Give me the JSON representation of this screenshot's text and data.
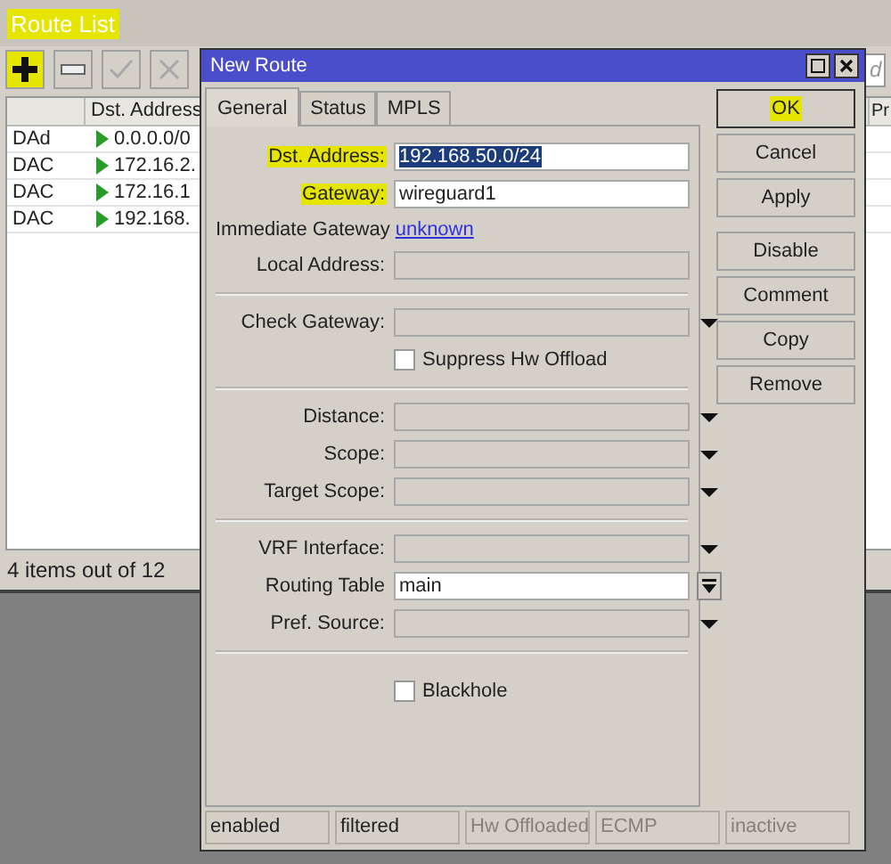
{
  "route_list": {
    "title": "Route List",
    "title_highlighted": true,
    "toolbar": [
      {
        "kind": "add",
        "highlighted": true,
        "disabled": false
      },
      {
        "kind": "remove",
        "highlighted": false,
        "disabled": false
      },
      {
        "kind": "enable",
        "highlighted": false,
        "disabled": true
      },
      {
        "kind": "disable",
        "highlighted": false,
        "disabled": true
      }
    ],
    "find_field": {
      "placeholder": "d"
    },
    "table": {
      "columns": [
        "Dst. Address",
        "Pr"
      ],
      "rows": [
        {
          "flags": "DAd",
          "dst_address": "0.0.0.0/0"
        },
        {
          "flags": "DAC",
          "dst_address": "172.16.2."
        },
        {
          "flags": "DAC",
          "dst_address": "172.16.1"
        },
        {
          "flags": "DAC",
          "dst_address": "192.168."
        }
      ]
    },
    "status": "4 items out of 12"
  },
  "dialog": {
    "title": "New Route",
    "tabs": [
      {
        "label": "General",
        "selected": true
      },
      {
        "label": "Status",
        "selected": false
      },
      {
        "label": "MPLS",
        "selected": false
      }
    ],
    "form": [
      {
        "kind": "text",
        "label": "Dst. Address:",
        "label_highlighted": true,
        "value": "192.168.50.0/24",
        "value_selected": true
      },
      {
        "kind": "text",
        "label": "Gateway:",
        "label_highlighted": true,
        "value": "wireguard1",
        "value_selected": false
      },
      {
        "kind": "link",
        "label": "Immediate Gateway",
        "value": "unknown"
      },
      {
        "kind": "readonly",
        "label": "Local Address:"
      },
      {
        "kind": "separator"
      },
      {
        "kind": "dropdown",
        "label": "Check Gateway:"
      },
      {
        "kind": "checkbox",
        "label": "Suppress Hw Offload",
        "checked": false
      },
      {
        "kind": "separator"
      },
      {
        "kind": "dropdown",
        "label": "Distance:"
      },
      {
        "kind": "dropdown",
        "label": "Scope:"
      },
      {
        "kind": "dropdown",
        "label": "Target Scope:"
      },
      {
        "kind": "separator"
      },
      {
        "kind": "dropdown",
        "label": "VRF Interface:"
      },
      {
        "kind": "combo",
        "label": "Routing Table",
        "value": "main"
      },
      {
        "kind": "dropdown",
        "label": "Pref. Source:"
      },
      {
        "kind": "separator"
      },
      {
        "kind": "checkbox",
        "label": "Blackhole",
        "checked": false
      }
    ],
    "button_groups": [
      [
        {
          "label": "OK",
          "highlighted": true,
          "default": true
        },
        {
          "label": "Cancel",
          "highlighted": false,
          "default": false
        },
        {
          "label": "Apply",
          "highlighted": false,
          "default": false
        }
      ],
      [
        {
          "label": "Disable",
          "highlighted": false,
          "default": false
        },
        {
          "label": "Comment",
          "highlighted": false,
          "default": false
        },
        {
          "label": "Copy",
          "highlighted": false,
          "default": false
        },
        {
          "label": "Remove",
          "highlighted": false,
          "default": false
        }
      ]
    ],
    "status_bar": [
      {
        "text": "enabled",
        "disabled": false
      },
      {
        "text": "filtered",
        "disabled": false
      },
      {
        "text": "Hw Offloaded",
        "disabled": true
      },
      {
        "text": "ECMP",
        "disabled": true
      },
      {
        "text": "inactive",
        "disabled": true
      }
    ]
  }
}
